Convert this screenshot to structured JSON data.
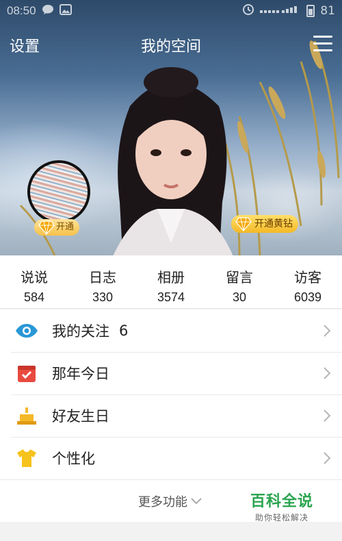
{
  "status_bar": {
    "time": "08:50",
    "battery": "81"
  },
  "nav": {
    "left": "设置",
    "title": "我的空间"
  },
  "cover": {
    "vip_badge": "开通",
    "yellow_diamond": "开通黄钻"
  },
  "stats": [
    {
      "label": "说说",
      "value": "584"
    },
    {
      "label": "日志",
      "value": "330"
    },
    {
      "label": "相册",
      "value": "3574"
    },
    {
      "label": "留言",
      "value": "30"
    },
    {
      "label": "访客",
      "value": "6039"
    }
  ],
  "list": [
    {
      "label": "我的关注",
      "count": "6",
      "icon": "eye-icon"
    },
    {
      "label": "那年今日",
      "icon": "calendar-icon"
    },
    {
      "label": "好友生日",
      "icon": "cake-icon"
    },
    {
      "label": "个性化",
      "icon": "tshirt-icon"
    }
  ],
  "more": {
    "label": "更多功能"
  },
  "watermark": {
    "title": "百科全说",
    "subtitle": "助你轻松解决"
  },
  "colors": {
    "accent_blue": "#2a97d6",
    "calendar_red": "#e94a3f",
    "gold": "#f4b928",
    "watermark_green": "#2aa44f"
  }
}
